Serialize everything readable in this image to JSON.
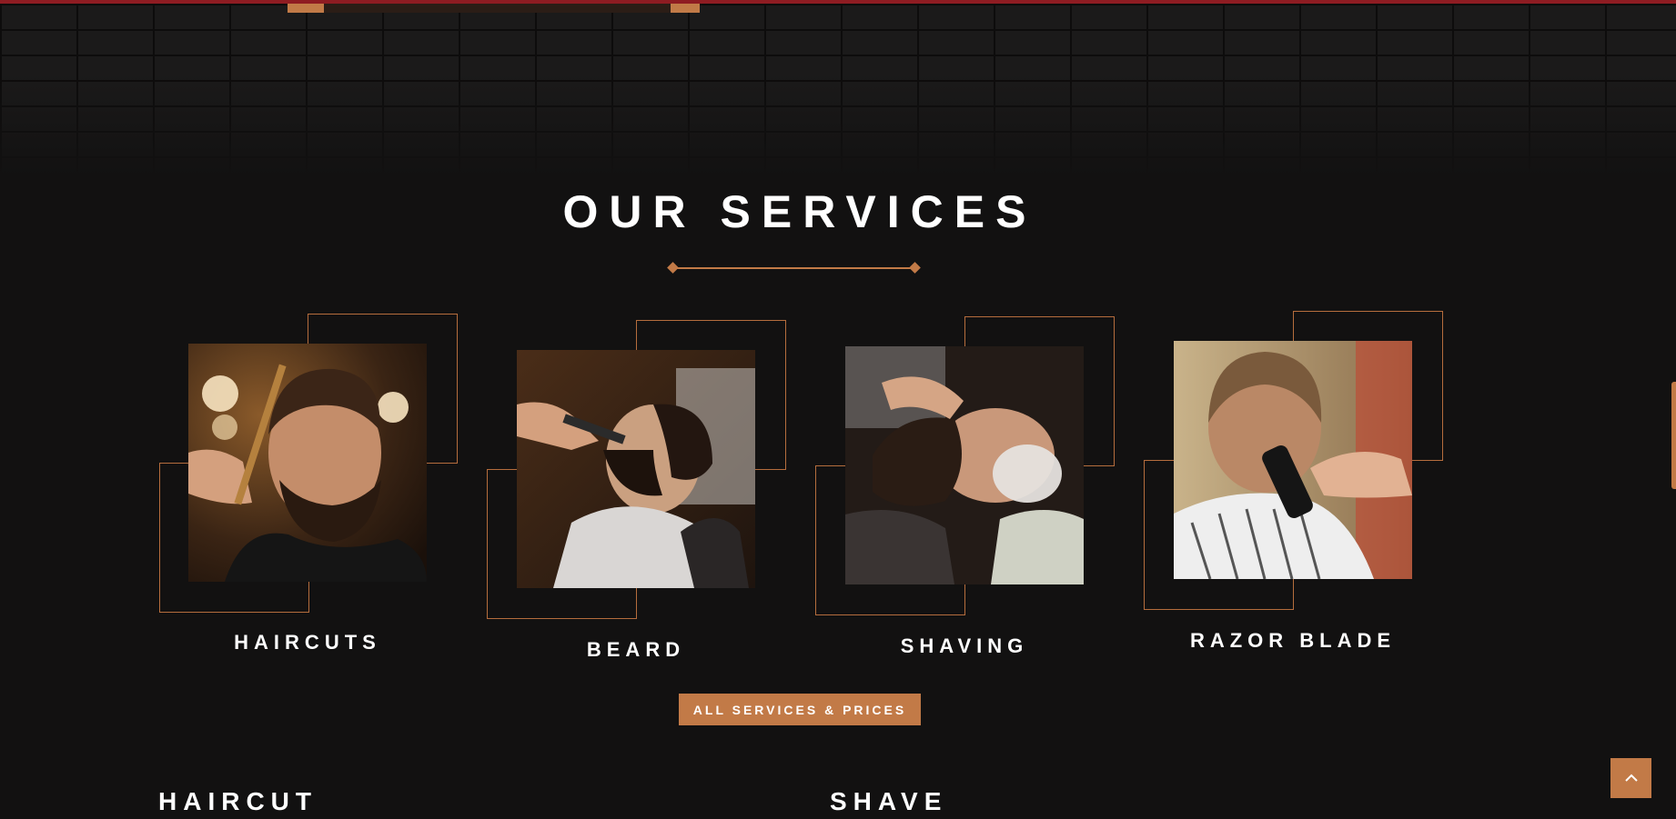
{
  "services": {
    "title": "OUR SERVICES",
    "items": [
      {
        "label": "HAIRCUTS",
        "image": "barber-combing-hair-photo"
      },
      {
        "label": "BEARD",
        "image": "beard-trim-photo"
      },
      {
        "label": "SHAVING",
        "image": "shaving-foam-photo"
      },
      {
        "label": "RAZOR BLADE",
        "image": "clipper-neck-photo"
      }
    ],
    "cta_label": "ALL SERVICES & PRICES"
  },
  "price_list": {
    "left_heading": "HAIRCUT",
    "right_heading": "SHAVE"
  },
  "icons": {
    "scroll_top": "chevron-up-icon",
    "divider": "diamond-divider"
  },
  "colors": {
    "accent": "#c27a47",
    "background": "#121111",
    "top_stripe": "#8e1c22",
    "text": "#ffffff"
  }
}
